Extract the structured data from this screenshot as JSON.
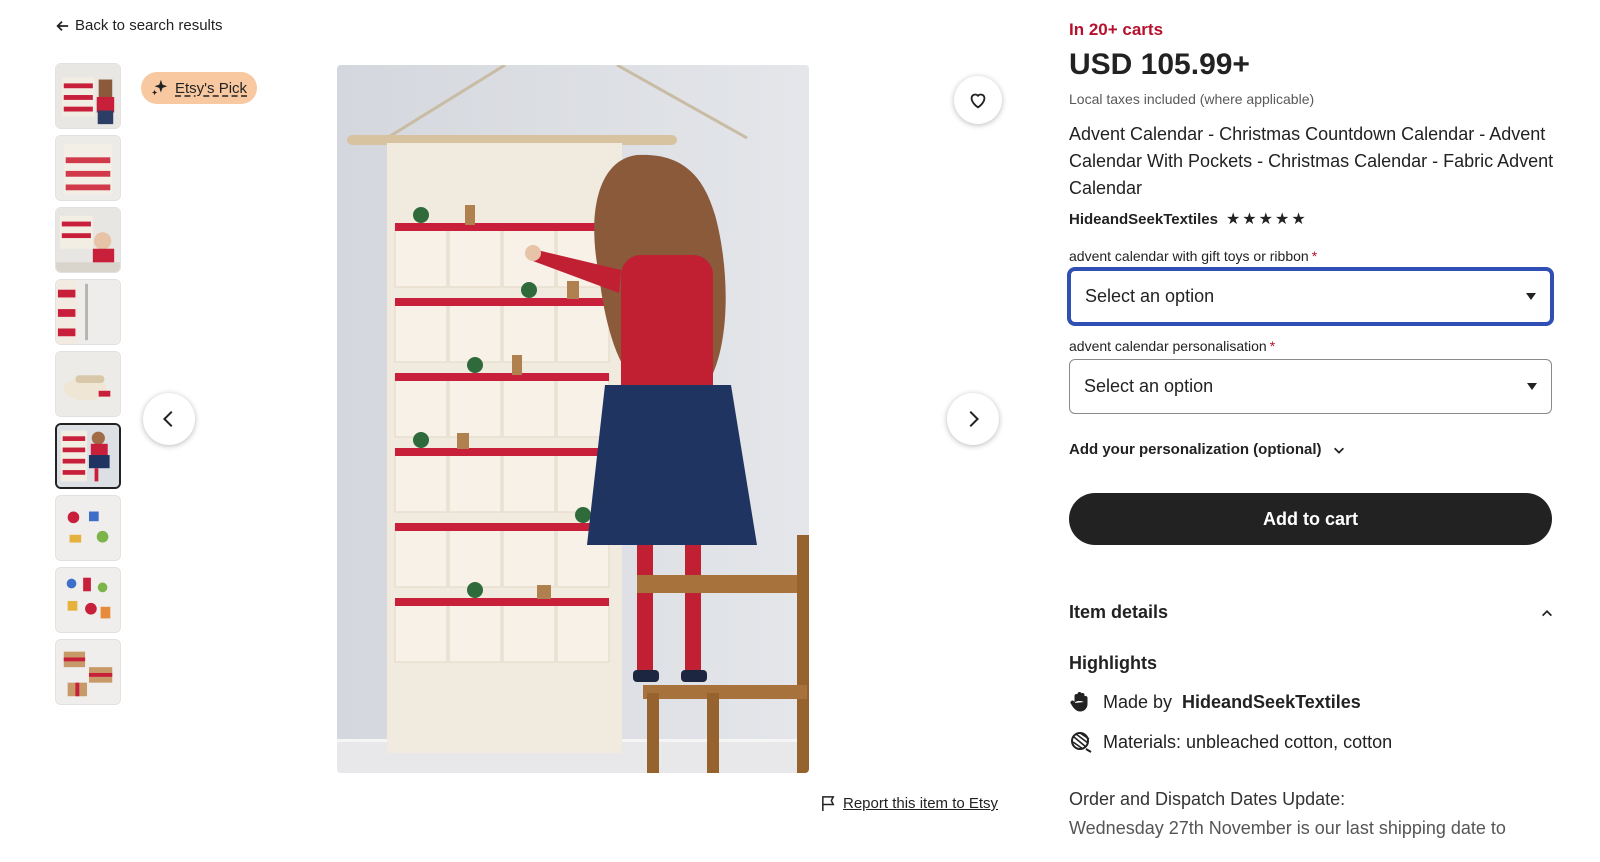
{
  "nav": {
    "back_label": "Back to search results",
    "back_icon": "arrow-left-icon"
  },
  "badge": {
    "label": "Etsy's Pick",
    "icon": "sparkle-icon"
  },
  "gallery": {
    "thumbnail_count": 9,
    "active_index": 5,
    "prev_icon": "chevron-left-icon",
    "next_icon": "chevron-right-icon",
    "favorite_icon": "heart-icon"
  },
  "report": {
    "label": "Report this item to Etsy",
    "icon": "flag-icon"
  },
  "product": {
    "in_carts": "In 20+ carts",
    "price": "USD 105.99+",
    "tax_note": "Local taxes included (where applicable)",
    "title": "Advent Calendar - Christmas Countdown Calendar - Advent Calendar With Pockets - Christmas Calendar - Fabric Advent Calendar",
    "shop_name": "HideandSeekTextiles",
    "rating": 5
  },
  "options": [
    {
      "label": "advent calendar with gift toys or ribbon",
      "required_mark": "*",
      "value": "Select an option"
    },
    {
      "label": "advent calendar personalisation",
      "required_mark": "*",
      "value": "Select an option"
    }
  ],
  "personalization": {
    "label": "Add your personalization (optional)"
  },
  "cart": {
    "label": "Add to cart"
  },
  "details": {
    "heading": "Item details",
    "highlights_heading": "Highlights",
    "made_by_prefix": "Made by",
    "made_by_shop": "HideandSeekTextiles",
    "materials": "Materials: unbleached cotton, cotton",
    "order_heading": "Order and Dispatch Dates Update:",
    "order_text": "Wednesday 27th November is our last shipping date to"
  },
  "colors": {
    "accent_red": "#b5112e",
    "badge_bg": "#f8c8a0",
    "focus_blue": "#2f4fb5",
    "cart_button": "#222222"
  }
}
